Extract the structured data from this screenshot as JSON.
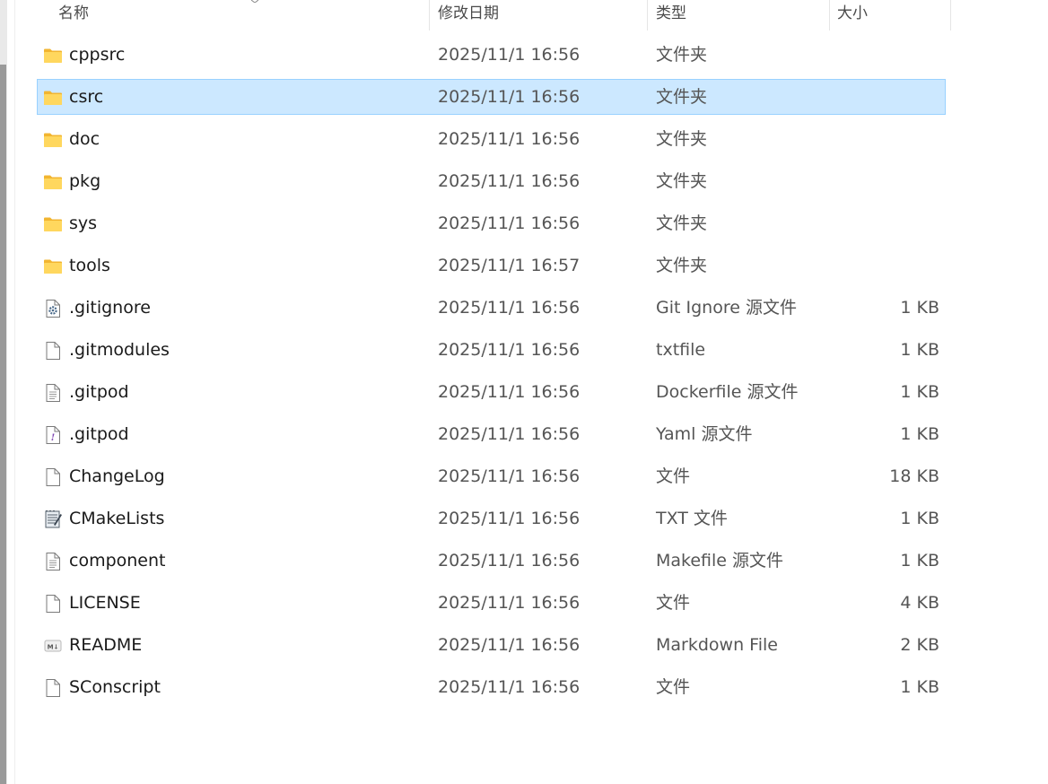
{
  "columns": {
    "name": "名称",
    "modified": "修改日期",
    "type": "类型",
    "size": "大小"
  },
  "files": [
    {
      "name": "cppsrc",
      "modified": "2025/11/1 16:56",
      "type": "文件夹",
      "size": "",
      "icon": "folder-icon",
      "selected": false
    },
    {
      "name": "csrc",
      "modified": "2025/11/1 16:56",
      "type": "文件夹",
      "size": "",
      "icon": "folder-icon",
      "selected": true
    },
    {
      "name": "doc",
      "modified": "2025/11/1 16:56",
      "type": "文件夹",
      "size": "",
      "icon": "folder-icon",
      "selected": false
    },
    {
      "name": "pkg",
      "modified": "2025/11/1 16:56",
      "type": "文件夹",
      "size": "",
      "icon": "folder-icon",
      "selected": false
    },
    {
      "name": "sys",
      "modified": "2025/11/1 16:56",
      "type": "文件夹",
      "size": "",
      "icon": "folder-icon",
      "selected": false
    },
    {
      "name": "tools",
      "modified": "2025/11/1 16:57",
      "type": "文件夹",
      "size": "",
      "icon": "folder-icon",
      "selected": false
    },
    {
      "name": ".gitignore",
      "modified": "2025/11/1 16:56",
      "type": "Git Ignore 源文件",
      "size": "1 KB",
      "icon": "gear-file-icon",
      "selected": false
    },
    {
      "name": ".gitmodules",
      "modified": "2025/11/1 16:56",
      "type": "txtfile",
      "size": "1 KB",
      "icon": "blank-file-icon",
      "selected": false
    },
    {
      "name": ".gitpod",
      "modified": "2025/11/1 16:56",
      "type": "Dockerfile 源文件",
      "size": "1 KB",
      "icon": "text-file-icon",
      "selected": false
    },
    {
      "name": ".gitpod",
      "modified": "2025/11/1 16:56",
      "type": "Yaml 源文件",
      "size": "1 KB",
      "icon": "yaml-file-icon",
      "selected": false
    },
    {
      "name": "ChangeLog",
      "modified": "2025/11/1 16:56",
      "type": "文件",
      "size": "18 KB",
      "icon": "blank-file-icon",
      "selected": false
    },
    {
      "name": "CMakeLists",
      "modified": "2025/11/1 16:56",
      "type": "TXT 文件",
      "size": "1 KB",
      "icon": "notepad-file-icon",
      "selected": false
    },
    {
      "name": "component",
      "modified": "2025/11/1 16:56",
      "type": "Makefile 源文件",
      "size": "1 KB",
      "icon": "text-file-icon",
      "selected": false
    },
    {
      "name": "LICENSE",
      "modified": "2025/11/1 16:56",
      "type": "文件",
      "size": "4 KB",
      "icon": "blank-file-icon",
      "selected": false
    },
    {
      "name": "README",
      "modified": "2025/11/1 16:56",
      "type": "Markdown File",
      "size": "2 KB",
      "icon": "markdown-file-icon",
      "selected": false
    },
    {
      "name": "SConscript",
      "modified": "2025/11/1 16:56",
      "type": "文件",
      "size": "1 KB",
      "icon": "blank-file-icon",
      "selected": false
    }
  ],
  "colors": {
    "selection_bg": "#cce8ff",
    "selection_border": "#99d1ff",
    "folder_yellow": "#ffd75e"
  }
}
